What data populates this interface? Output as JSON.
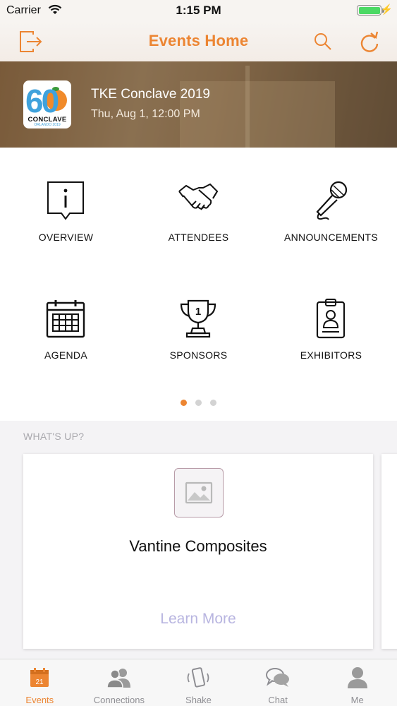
{
  "status_bar": {
    "carrier": "Carrier",
    "time": "1:15 PM",
    "battery_level": 1.0
  },
  "nav": {
    "title": "Events Home",
    "left_icon": "logout-icon",
    "right_icons": [
      "search-icon",
      "refresh-icon"
    ]
  },
  "event": {
    "title": "TKE Conclave 2019",
    "date": "Thu, Aug 1, 12:00 PM",
    "logo": {
      "number": "60",
      "word": "CONCLAVE",
      "sub": "ORLANDO 2019"
    }
  },
  "menu": {
    "items": [
      {
        "label": "OVERVIEW",
        "icon": "info-icon"
      },
      {
        "label": "ATTENDEES",
        "icon": "handshake-icon"
      },
      {
        "label": "ANNOUNCEMENTS",
        "icon": "microphone-icon"
      },
      {
        "label": "AGENDA",
        "icon": "calendar-icon"
      },
      {
        "label": "SPONSORS",
        "icon": "trophy-icon"
      },
      {
        "label": "EXHIBITORS",
        "icon": "badge-icon"
      }
    ],
    "page_count": 3,
    "active_page": 1
  },
  "whats_up": {
    "label": "WHAT'S UP?",
    "cards": [
      {
        "title": "Vantine Composites",
        "link": "Learn More"
      }
    ]
  },
  "tab_bar": {
    "tabs": [
      {
        "label": "Events",
        "icon": "calendar-icon",
        "badge_text": "21",
        "active": true
      },
      {
        "label": "Connections",
        "icon": "people-icon",
        "active": false
      },
      {
        "label": "Shake",
        "icon": "shake-phone-icon",
        "active": false
      },
      {
        "label": "Chat",
        "icon": "chat-bubbles-icon",
        "active": false
      },
      {
        "label": "Me",
        "icon": "person-icon",
        "active": false
      }
    ]
  },
  "colors": {
    "accent": "#ec8532",
    "link": "#b8b5e0",
    "brand_blue": "#3fa2dc"
  }
}
